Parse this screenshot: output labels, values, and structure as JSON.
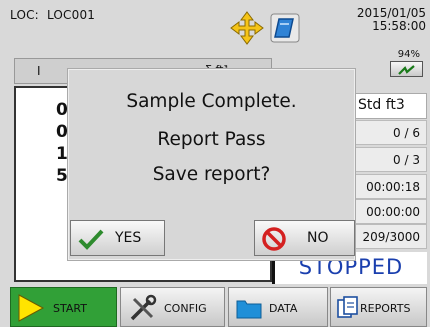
{
  "header": {
    "loc_label": "LOC:",
    "loc_value": "LOC001",
    "date": "2015/01/05",
    "time": "15:58:00",
    "battery_percent": "94%"
  },
  "table": {
    "col1": "I",
    "col2": "Σ ft³",
    "digits": [
      "0",
      "0",
      "1",
      "5"
    ]
  },
  "info": {
    "unit": "Std ft3",
    "row1": "0 / 6",
    "row2": "0 / 3",
    "row3": "00:00:18",
    "row4": "00:00:00",
    "row5": "209/3000"
  },
  "status": "STOPPED",
  "tabs": {
    "start": "START",
    "config": "CONFIG",
    "data": "DATA",
    "reports": "REPORTS"
  },
  "dialog": {
    "line1": "Sample Complete.",
    "line2": "Report Pass",
    "line3": "Save report?",
    "yes": "YES",
    "no": "NO"
  },
  "colors": {
    "start_tab": "#31a037",
    "status_text": "#1a3fae",
    "yes_check": "#2e8b2e",
    "no_icon": "#d42020"
  },
  "icons": [
    "move-arrows-icon",
    "book-icon",
    "power-icon",
    "play-icon",
    "tools-icon",
    "folder-icon",
    "reports-icon",
    "check-icon",
    "no-entry-icon"
  ]
}
